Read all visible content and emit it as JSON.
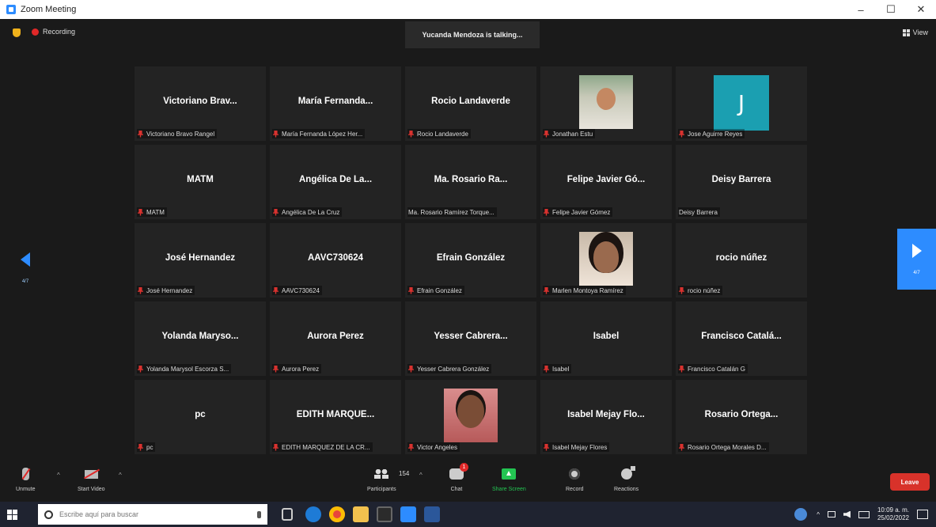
{
  "window": {
    "title": "Zoom Meeting",
    "controls": [
      "–",
      "☐",
      "✕"
    ]
  },
  "topbar": {
    "recording_label": "Recording",
    "talking_text": "Yucanda Mendoza is talking...",
    "view_label": "View"
  },
  "pager": {
    "left_label": "4/7",
    "right_label": "4/7"
  },
  "tiles": [
    {
      "name": "Victoriano Brav...",
      "label": "Victoriano Bravo Rangel",
      "muted": true,
      "kind": "text"
    },
    {
      "name": "María Fernanda...",
      "label": "María Fernanda López Her...",
      "muted": true,
      "kind": "text"
    },
    {
      "name": "Rocio Landaverde",
      "label": "Rocio Landaverde",
      "muted": true,
      "kind": "text"
    },
    {
      "name": "",
      "label": "Jonathan Estu",
      "muted": true,
      "kind": "photo1"
    },
    {
      "name": "J",
      "label": "Jose Aguirre Reyes",
      "muted": true,
      "kind": "avatar"
    },
    {
      "name": "MATM",
      "label": "MATM",
      "muted": true,
      "kind": "text"
    },
    {
      "name": "Angélica De La...",
      "label": "Angélica De La Cruz",
      "muted": true,
      "kind": "text"
    },
    {
      "name": "Ma. Rosario Ra...",
      "label": "Ma. Rosario Ramírez Torque...",
      "muted": false,
      "kind": "text"
    },
    {
      "name": "Felipe Javier Gó...",
      "label": "Felipe Javier Gómez",
      "muted": true,
      "kind": "text"
    },
    {
      "name": "Deisy Barrera",
      "label": "Deisy Barrera",
      "muted": false,
      "kind": "text"
    },
    {
      "name": "José Hernandez",
      "label": "José Hernandez",
      "muted": true,
      "kind": "text"
    },
    {
      "name": "AAVC730624",
      "label": "AAVC730624",
      "muted": true,
      "kind": "text"
    },
    {
      "name": "Efrain González",
      "label": "Efrain González",
      "muted": true,
      "kind": "text"
    },
    {
      "name": "",
      "label": "Marlen Montoya Ramírez",
      "muted": true,
      "kind": "photo2"
    },
    {
      "name": "rocio núñez",
      "label": "rocio núñez",
      "muted": true,
      "kind": "text"
    },
    {
      "name": "Yolanda Maryso...",
      "label": "Yolanda Marysol Escorza S...",
      "muted": true,
      "kind": "text"
    },
    {
      "name": "Aurora Perez",
      "label": "Aurora Perez",
      "muted": true,
      "kind": "text"
    },
    {
      "name": "Yesser Cabrera...",
      "label": "Yesser Cabrera González",
      "muted": true,
      "kind": "text"
    },
    {
      "name": "Isabel",
      "label": "Isabel",
      "muted": true,
      "kind": "text"
    },
    {
      "name": "Francisco Catalá...",
      "label": "Francisco Catalán G",
      "muted": true,
      "kind": "text"
    },
    {
      "name": "pc",
      "label": "pc",
      "muted": true,
      "kind": "text"
    },
    {
      "name": "EDITH MARQUE...",
      "label": "EDITH MARQUEZ DE LA CR...",
      "muted": true,
      "kind": "text"
    },
    {
      "name": "",
      "label": "Victor Angeles",
      "muted": true,
      "kind": "photo3"
    },
    {
      "name": "Isabel Mejay Flo...",
      "label": "Isabel Mejay Flores",
      "muted": true,
      "kind": "text"
    },
    {
      "name": "Rosario Ortega...",
      "label": "Rosario Ortega Morales D...",
      "muted": true,
      "kind": "text"
    }
  ],
  "toolbar": {
    "unmute": "Unmute",
    "start_video": "Start Video",
    "participants": "Participants",
    "participant_count": "154",
    "chat": "Chat",
    "chat_badge": "1",
    "share_screen": "Share Screen",
    "record": "Record",
    "reactions": "Reactions",
    "leave": "Leave"
  },
  "taskbar": {
    "search_placeholder": "Escribe aquí para buscar",
    "time": "10:09 a. m.",
    "date": "25/02/2022"
  },
  "colors": {
    "accent": "#2d8cff",
    "leave": "#d8322a",
    "share": "#23c552",
    "muted": "#d9322f"
  }
}
